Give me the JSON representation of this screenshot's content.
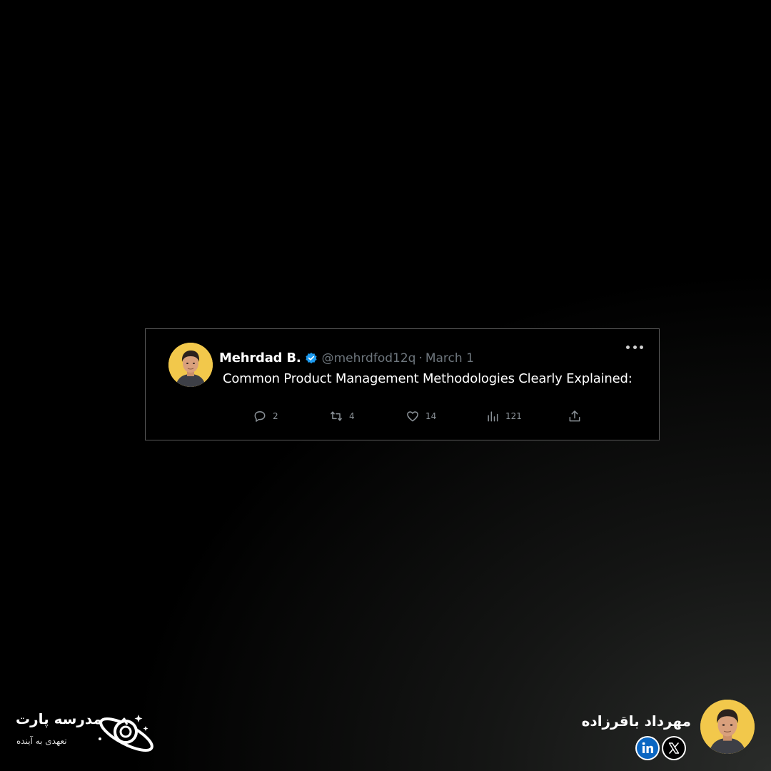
{
  "tweet": {
    "author_name": "Mehrdad B.",
    "handle": "@mehrdfod12q",
    "separator": "·",
    "date": "March 1",
    "text": "Common Product Management Methodologies Clearly Explained:",
    "verified": true,
    "actions": {
      "replies": "2",
      "retweets": "4",
      "likes": "14",
      "views": "121"
    }
  },
  "footer": {
    "brand_name": "مدرسه پارت",
    "brand_tagline": "تعهدی به آینده",
    "author_name": "مهرداد باقرزاده",
    "social": [
      "linkedin-icon",
      "x-icon"
    ]
  },
  "colors": {
    "verified_blue": "#1d9bf0",
    "avatar_bg": "#f2c84b",
    "muted_text": "#6e767d",
    "linkedin_blue": "#0a66c2"
  }
}
